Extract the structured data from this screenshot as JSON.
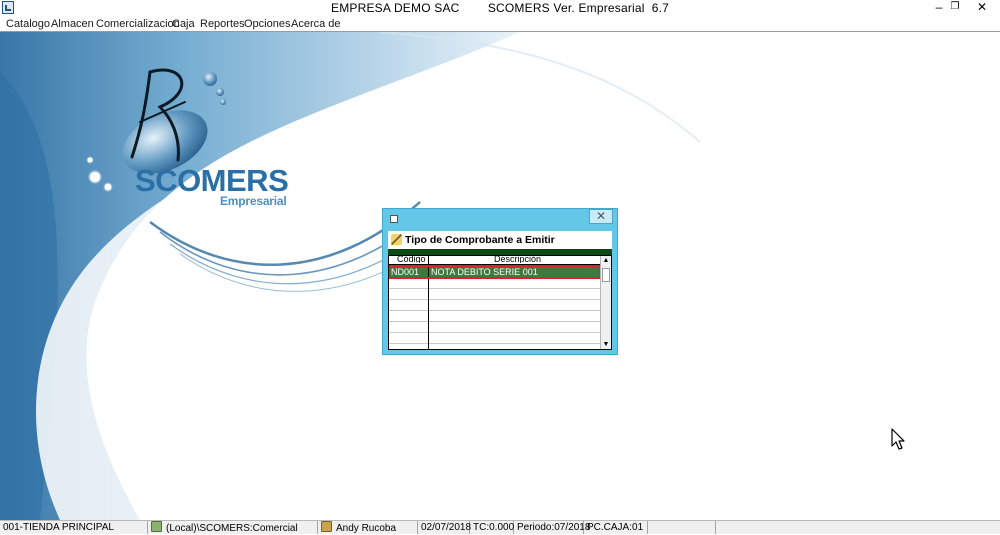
{
  "window": {
    "title": "EMPRESA DEMO SAC        SCOMERS Ver. Empresarial  6.7",
    "minimize_glyph": "–",
    "restore_glyph": "❐",
    "close_glyph": "✕",
    "icon": "app-icon"
  },
  "menu": {
    "items": [
      "Catalogo",
      "Almacen",
      "Comercializacion",
      "Caja",
      "Reportes",
      "Opciones",
      "Acerca de"
    ]
  },
  "brand": {
    "name": "SCOMERS",
    "subtitle": "Empresarial",
    "colors": {
      "primary": "#2a6fa8",
      "light": "#8fc0df"
    }
  },
  "dialog": {
    "heading": "Tipo de Comprobante a Emitir",
    "heading_icon": "pen-icon",
    "close_glyph": "✕",
    "colors": {
      "frame": "#63c7e8",
      "header_bar": "#0b4a12",
      "selected_row": "#3e7a3e",
      "highlight": "#e0202a"
    },
    "columns": [
      "Código",
      "Descripción"
    ],
    "rows": [
      {
        "code": "ND001",
        "description": "NOTA DEBITO SERIE 001",
        "selected": true
      }
    ]
  },
  "statusbar": {
    "store": "001-TIENDA PRINCIPAL",
    "database": "(Local)\\SCOMERS:Comercial",
    "user": "Andy Rucoba",
    "date": "02/07/2018",
    "exchange_rate": "TC:0.000",
    "period": "Periodo:07/2018",
    "terminal": "PC.CAJA:01"
  }
}
